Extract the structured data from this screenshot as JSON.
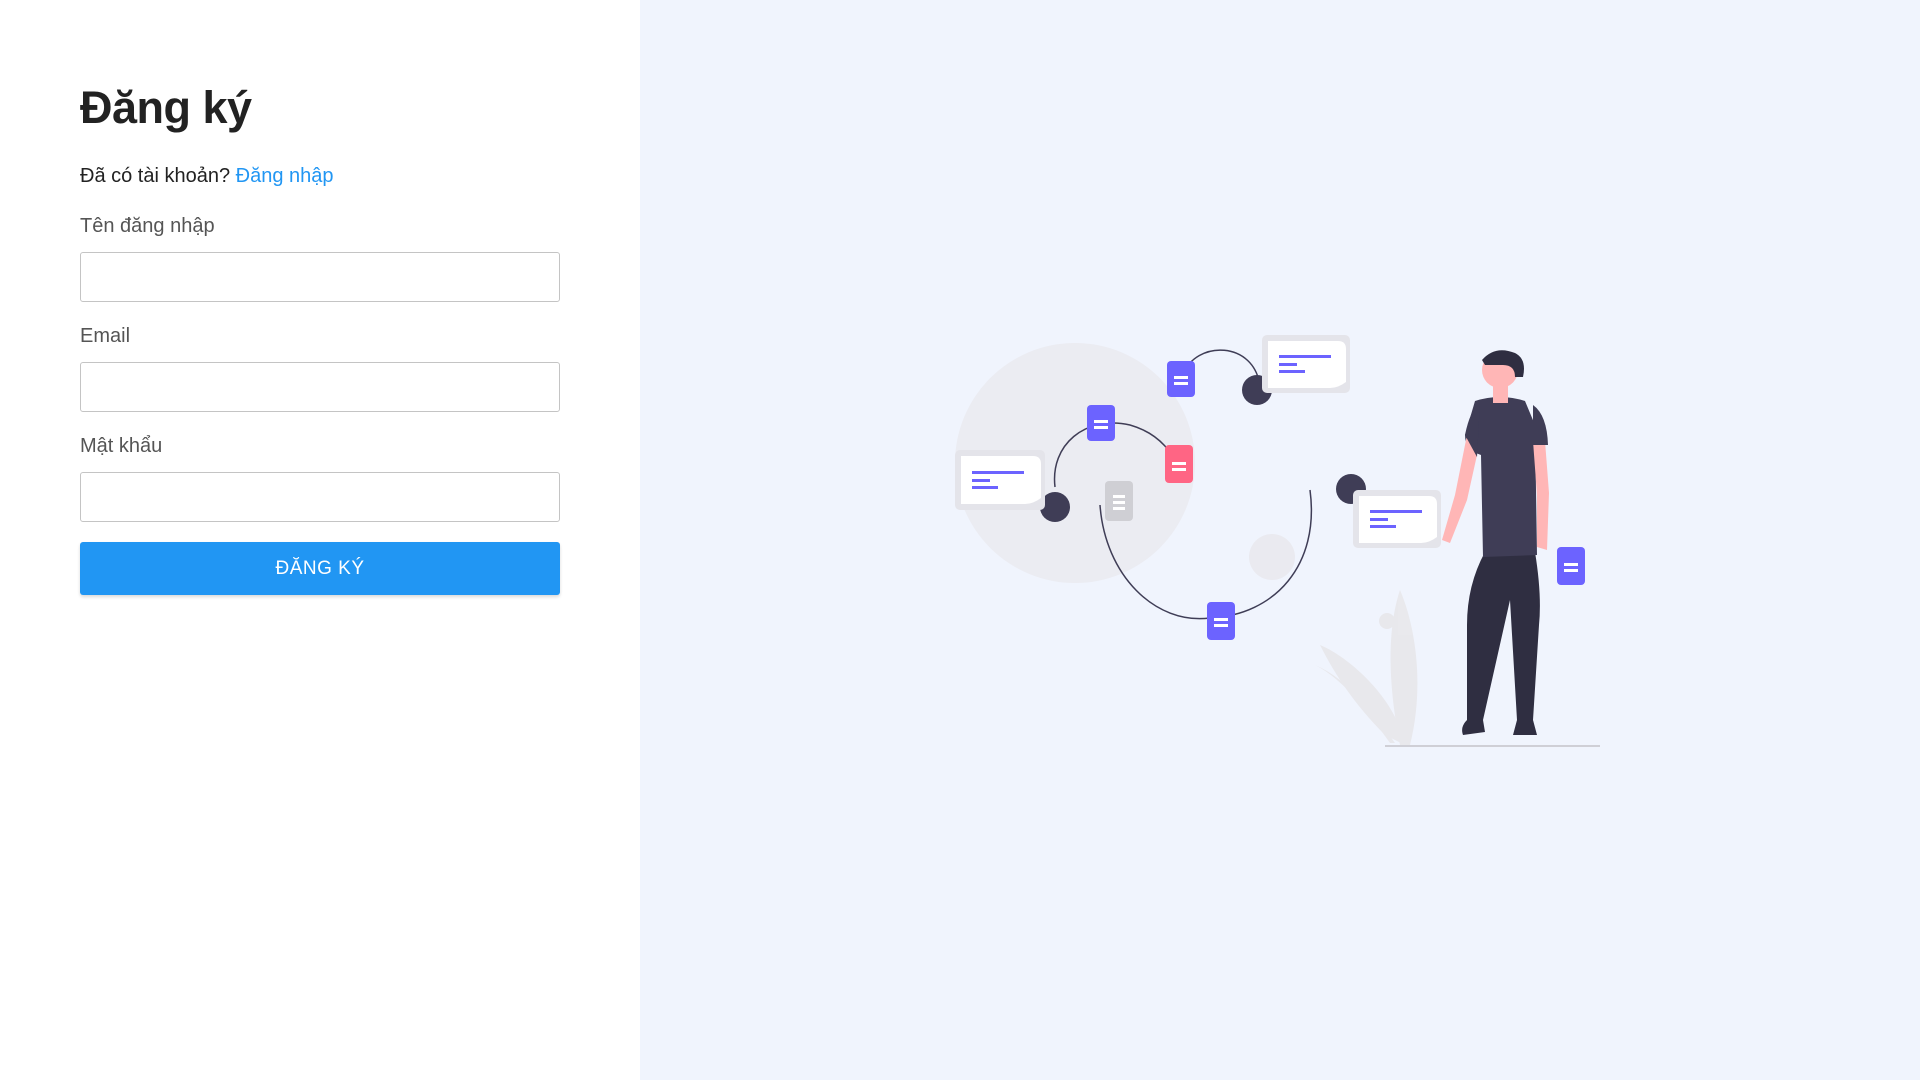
{
  "register": {
    "title": "Đăng ký",
    "have_account_text": "Đã có tài khoản?",
    "login_link": "Đăng nhập",
    "username_label": "Tên đăng nhập",
    "username_value": "",
    "email_label": "Email",
    "email_value": "",
    "password_label": "Mật khẩu",
    "password_value": "",
    "submit_label": "ĐĂNG KÝ"
  },
  "colors": {
    "accent": "#2196f3",
    "right_panel_bg": "#f0f4fd",
    "illustration_primary": "#6c63ff",
    "illustration_secondary": "#ff6584",
    "illustration_dark": "#3f3d56"
  },
  "icons": [
    "document-icon",
    "chat-bubble-icon",
    "person-illustration"
  ]
}
